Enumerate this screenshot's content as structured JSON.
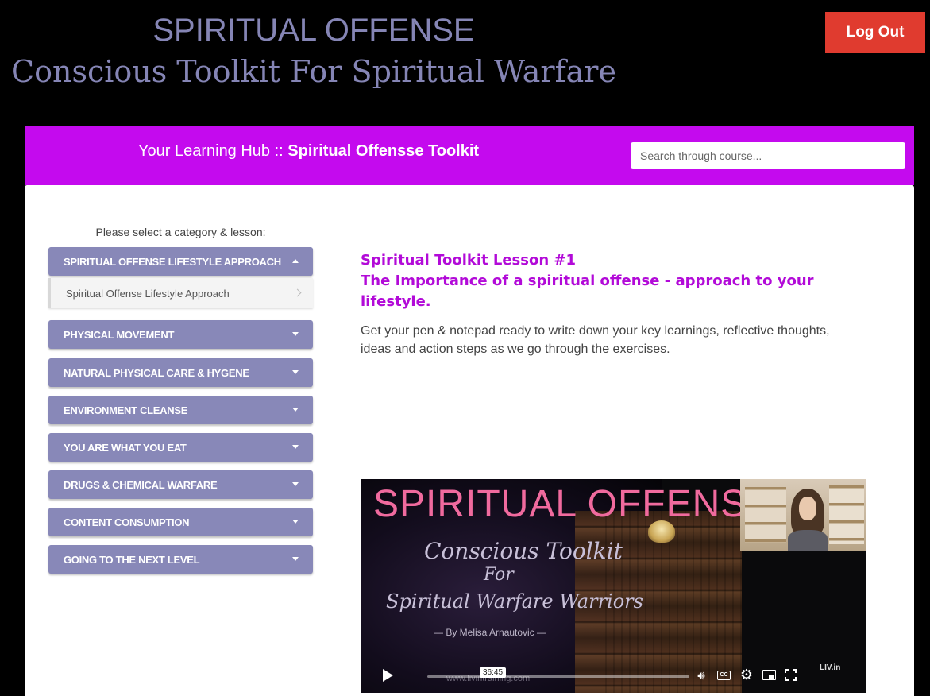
{
  "header": {
    "title_line1": "SPIRITUAL OFFENSE",
    "title_line2": "Conscious Toolkit For Spiritual Warfare",
    "logout_label": "Log Out"
  },
  "hub": {
    "prefix": "Your Learning Hub ::",
    "course_name": "Spiritual Offensse Toolkit",
    "search_placeholder": "Search through course..."
  },
  "sidebar": {
    "prompt": "Please select a category & lesson:",
    "categories": [
      {
        "label": "SPIRITUAL OFFENSE LIFESTYLE APPROACH",
        "expanded": true
      },
      {
        "label": "PHYSICAL MOVEMENT",
        "expanded": false
      },
      {
        "label": "NATURAL PHYSICAL CARE & HYGENE",
        "expanded": false
      },
      {
        "label": "ENVIRONMENT CLEANSE",
        "expanded": false
      },
      {
        "label": "YOU ARE WHAT YOU EAT",
        "expanded": false
      },
      {
        "label": "DRUGS & CHEMICAL WARFARE",
        "expanded": false
      },
      {
        "label": "CONTENT CONSUMPTION",
        "expanded": false
      },
      {
        "label": "GOING TO THE NEXT LEVEL",
        "expanded": false
      }
    ],
    "lessons": [
      {
        "label": "Spiritual Offense Lifestyle Approach"
      }
    ]
  },
  "lesson": {
    "number_line": "Spiritual Toolkit Lesson #1",
    "title": "The Importance of a spiritual offense - approach to your lifestyle.",
    "description": "Get your pen & notepad ready to write down your key learnings, reflective thoughts, ideas and action steps as we go through the exercises."
  },
  "video": {
    "thumb_title": "SPIRITUAL OFFENSE",
    "thumb_script1": "Conscious Toolkit",
    "thumb_script2": "For",
    "thumb_script3": "Spiritual Warfare Warriors",
    "thumb_byline": "— By Melisa Arnautovic —",
    "thumb_site": "www.livintraining.com",
    "brand_watermark": "LIV.in",
    "duration": "36:45",
    "cc_label": "CC"
  },
  "colors": {
    "hub_bar": "#c40aee",
    "category_bg": "#8888b8",
    "lesson_heading": "#b20ad8",
    "logout_bg": "#e03b2f",
    "title_text": "#8585b5"
  },
  "icons": {
    "play": "play-icon",
    "volume": "volume-icon",
    "captions": "captions-icon",
    "settings": "gear-icon",
    "pip": "picture-in-picture-icon",
    "fullscreen": "fullscreen-icon",
    "caret_up": "caret-up-icon",
    "caret_down": "caret-down-icon",
    "chevron_right": "chevron-right-icon"
  }
}
